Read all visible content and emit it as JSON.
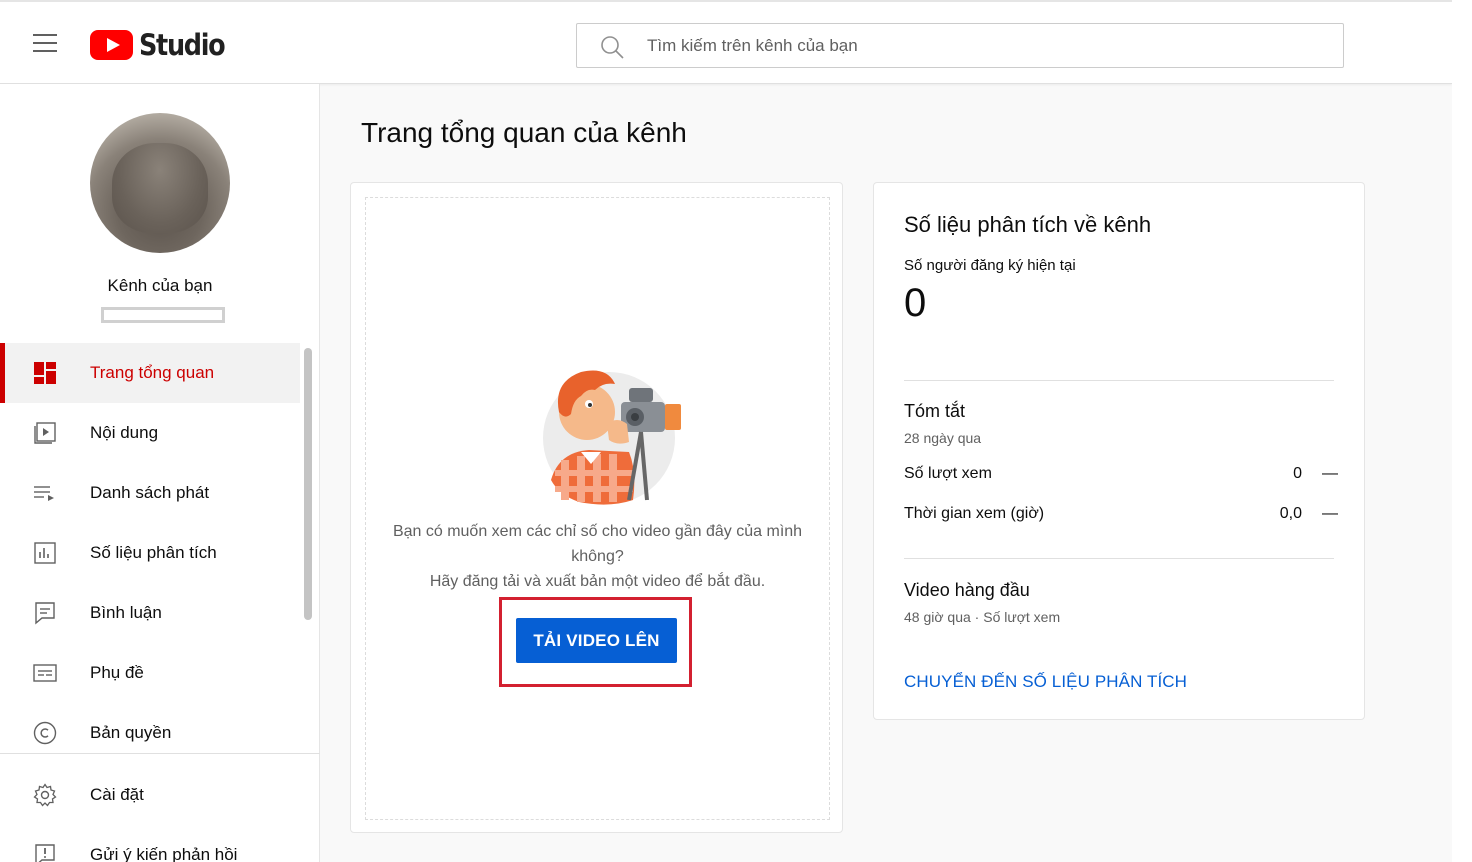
{
  "header": {
    "logo_text": "Studio",
    "search_placeholder": "Tìm kiếm trên kênh của bạn"
  },
  "sidebar": {
    "channel_name": "Kênh của bạn",
    "items": [
      {
        "label": "Trang tổng quan",
        "icon": "dashboard-icon",
        "active": true
      },
      {
        "label": "Nội dung",
        "icon": "content-icon"
      },
      {
        "label": "Danh sách phát",
        "icon": "playlist-icon"
      },
      {
        "label": "Số liệu phân tích",
        "icon": "analytics-icon"
      },
      {
        "label": "Bình luận",
        "icon": "comments-icon"
      },
      {
        "label": "Phụ đề",
        "icon": "subtitles-icon"
      },
      {
        "label": "Bản quyền",
        "icon": "copyright-icon"
      },
      {
        "label": "Cài đặt",
        "icon": "gear-icon"
      },
      {
        "label": "Gửi ý kiến phản hồi",
        "icon": "feedback-icon"
      }
    ]
  },
  "main": {
    "page_title": "Trang tổng quan của kênh",
    "upload_card": {
      "message_line1": "Bạn có muốn xem các chỉ số cho video gần đây của mình không?",
      "message_line2": "Hãy đăng tải và xuất bản một video để bắt đầu.",
      "button_label": "TẢI VIDEO LÊN"
    },
    "analytics_card": {
      "title": "Số liệu phân tích về kênh",
      "subscribers_label": "Số người đăng ký hiện tại",
      "subscribers_count": "0",
      "summary_title": "Tóm tắt",
      "summary_period": "28 ngày qua",
      "metrics": [
        {
          "label": "Số lượt xem",
          "value": "0",
          "trend": "—"
        },
        {
          "label": "Thời gian xem (giờ)",
          "value": "0,0",
          "trend": "—"
        }
      ],
      "top_videos_title": "Video hàng đầu",
      "top_videos_period": "48 giờ qua · Số lượt xem",
      "link_label": "CHUYỂN ĐẾN SỐ LIỆU PHÂN TÍCH"
    }
  },
  "colors": {
    "accent_red": "#cc0000",
    "button_blue": "#065fd4",
    "highlight_red": "#d32030"
  }
}
